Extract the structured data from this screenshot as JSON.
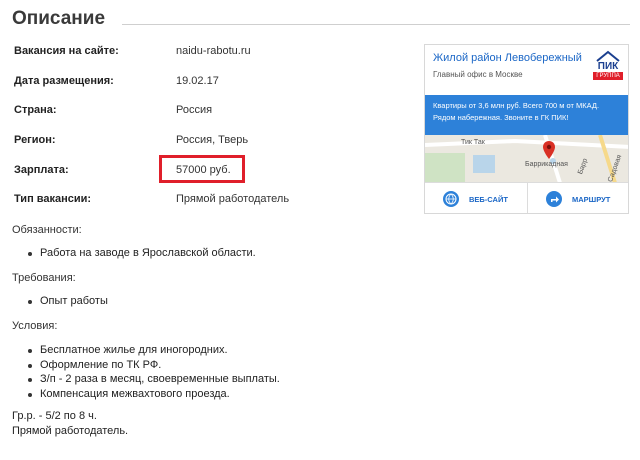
{
  "page": {
    "title": "Описание"
  },
  "details": [
    {
      "label": "Вакансия на сайте:",
      "value": "naidu-rabotu.ru"
    },
    {
      "label": "Дата размещения:",
      "value": "19.02.17"
    },
    {
      "label": "Страна:",
      "value": "Россия"
    },
    {
      "label": "Регион:",
      "value": "Россия, Тверь"
    },
    {
      "label": "Зарплата:",
      "value": "57000 руб."
    },
    {
      "label": "Тип вакансии:",
      "value": "Прямой работодатель"
    }
  ],
  "sections": {
    "duties": {
      "heading": "Обязанности:",
      "items": [
        "Работа на заводе в Ярославской области."
      ]
    },
    "requirements": {
      "heading": "Требования:",
      "items": [
        "Опыт работы"
      ]
    },
    "conditions": {
      "heading": "Условия:",
      "items": [
        "Бесплатное жилье для иногородних.",
        "Оформление по ТК РФ.",
        "З/п - 2 раза в месяц, своевременные выплаты.",
        "Компенсация межвахтового проезда."
      ]
    }
  },
  "footer": {
    "line1": "Гр.р. - 5/2 по 8 ч.",
    "line2": "Прямой работодатель."
  },
  "ad": {
    "title": "Жилой район Левобережный",
    "subtitle": "Главный офис в Москве",
    "logo_text": "ПИК",
    "logo_sub": "ГРУППА",
    "banner_text": "Квартиры от 3,6 млн руб. Всего 700 м от МКАД. Рядом набережная. Звоните в ГК ПИК!",
    "map_labels": [
      "Тик Так",
      "Баррикадная",
      "Садовая",
      "Барр"
    ],
    "website_button": "ВЕБ-САЙТ",
    "route_button": "МАРШРУТ"
  },
  "colors": {
    "highlight": "#e01f2a",
    "ad_blue": "#2d81d9",
    "link_blue": "#1a66c6"
  }
}
